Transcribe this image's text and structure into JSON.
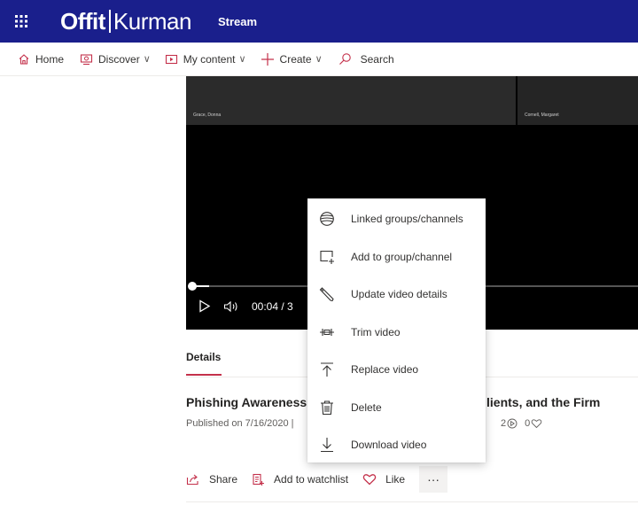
{
  "header": {
    "logo_left": "Offit",
    "logo_right": "Kurman",
    "app_name": "Stream"
  },
  "nav": {
    "items": [
      {
        "label": "Home",
        "icon": "home-icon",
        "has_dropdown": false
      },
      {
        "label": "Discover",
        "icon": "discover-icon",
        "has_dropdown": true
      },
      {
        "label": "My content",
        "icon": "my-content-icon",
        "has_dropdown": true
      },
      {
        "label": "Create",
        "icon": "plus-icon",
        "has_dropdown": true
      },
      {
        "label": "Search",
        "icon": "search-icon",
        "has_dropdown": false
      }
    ]
  },
  "player": {
    "participant_left": "Grace, Donna",
    "participant_right": "Cornell, Margaret",
    "time": "00:04 / 3",
    "progress": 0.04
  },
  "tabs": {
    "details": "Details"
  },
  "video_info": {
    "title_start": "Phishing Awareness",
    "title_end": "lients, and the Firm",
    "published": "Published on 7/16/2020 |",
    "views": "2",
    "likes": "0"
  },
  "actions": {
    "share": "Share",
    "add_to_watchlist": "Add to watchlist",
    "like": "Like",
    "more": "···"
  },
  "context_menu": {
    "items": [
      {
        "label": "Linked groups/channels",
        "icon": "linked-groups-icon"
      },
      {
        "label": "Add to group/channel",
        "icon": "add-to-group-icon"
      },
      {
        "label": "Update video details",
        "icon": "pencil-icon"
      },
      {
        "label": "Trim video",
        "icon": "trim-icon"
      },
      {
        "label": "Replace video",
        "icon": "upload-icon"
      },
      {
        "label": "Delete",
        "icon": "trash-icon"
      },
      {
        "label": "Download video",
        "icon": "download-icon"
      }
    ]
  },
  "colors": {
    "header_bg": "#1a1f8c",
    "accent": "#c4314b",
    "nav_icon": "#c4314b"
  }
}
